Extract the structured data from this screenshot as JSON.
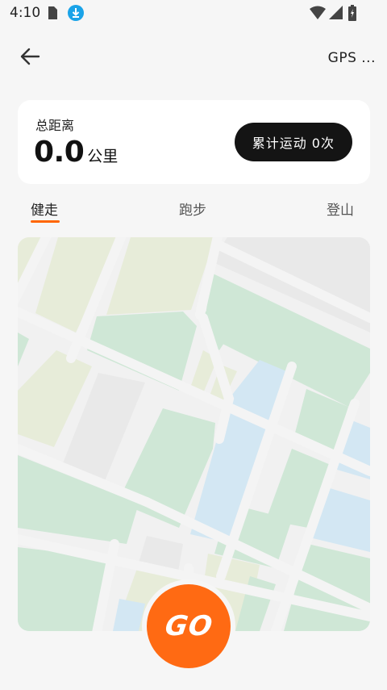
{
  "status_bar": {
    "time": "4:10",
    "icons": [
      "sim-card-icon",
      "download-icon",
      "wifi-icon",
      "signal-icon",
      "battery-icon"
    ]
  },
  "header": {
    "back_icon": "arrow-left-icon",
    "gps_label": "GPS ..."
  },
  "summary": {
    "distance_label": "总距离",
    "distance_value": "0.0",
    "distance_unit": "公里",
    "total_workouts_label": "累计运动 0次"
  },
  "tabs": [
    {
      "label": "健走",
      "active": true
    },
    {
      "label": "跑步",
      "active": false
    },
    {
      "label": "登山",
      "active": false
    }
  ],
  "go_button": {
    "label": "GO"
  },
  "colors": {
    "accent": "#ff6a13",
    "card_background": "#ffffff",
    "page_background": "#f6f6f6",
    "pill_background": "#141414",
    "map_green": "#cfe7d6",
    "map_blue": "#d3e7f3",
    "map_olive": "#e7ecd9",
    "map_gray": "#e9e9e9"
  }
}
